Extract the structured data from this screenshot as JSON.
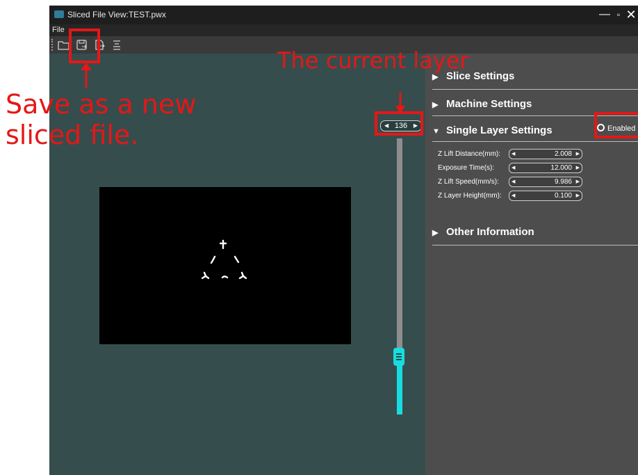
{
  "window": {
    "title": "Sliced File View:TEST.pwx",
    "controls": {
      "minimize_icon": "minimize-icon",
      "maximize_icon": "maximize-icon",
      "close_icon": "close-icon"
    }
  },
  "menu": {
    "items": [
      "File"
    ]
  },
  "toolbar": {
    "buttons": [
      {
        "icon": "open-folder-icon"
      },
      {
        "icon": "save-as-icon"
      },
      {
        "icon": "export-icon"
      },
      {
        "icon": "list-icon"
      }
    ]
  },
  "viewport": {
    "current_layer": "136",
    "slider_level_fraction": 0.18
  },
  "panel": {
    "sections": [
      {
        "label": "Slice Settings",
        "expanded": false
      },
      {
        "label": "Machine Settings",
        "expanded": false
      },
      {
        "label": "Single Layer Settings",
        "expanded": true
      },
      {
        "label": "Other Information",
        "expanded": false
      }
    ],
    "enabled_label": "Enabled",
    "params": [
      {
        "label": "Z Lift Distance(mm):",
        "value": "2.008"
      },
      {
        "label": "Exposure Time(s):",
        "value": "12.000"
      },
      {
        "label": "Z Lift Speed(mm/s):",
        "value": "9.986"
      },
      {
        "label": "Z Layer Height(mm):",
        "value": "0.100"
      }
    ]
  },
  "annotations": {
    "save_note": [
      "Save as a new",
      "sliced file."
    ],
    "layer_note": "The current layer",
    "color": "#e51717"
  },
  "colors": {
    "accent": "#18dde0",
    "viewport_bg": "#364d4d",
    "panel_bg": "#4d4d4d"
  }
}
